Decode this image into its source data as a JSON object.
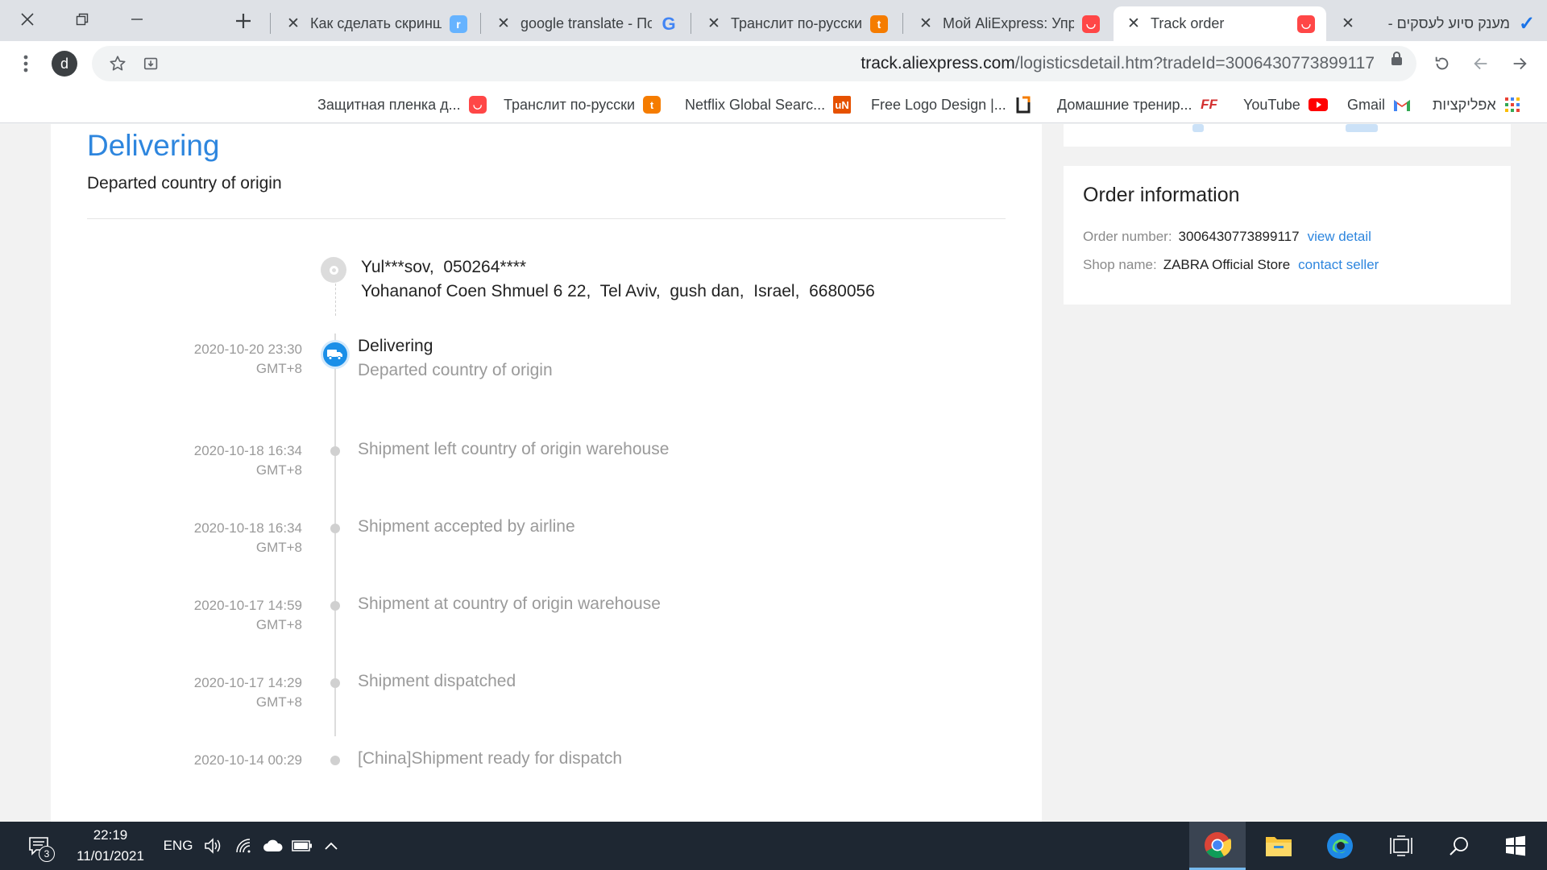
{
  "browser": {
    "tabs": [
      {
        "title": "מענק סיוע לעסקים -",
        "favicon_color": "#1a73e8"
      },
      {
        "title": "Track order",
        "favicon_color": "#ff4747"
      },
      {
        "title": "Мой AliExpress: Упра",
        "favicon_color": "#ff4747"
      },
      {
        "title": "Транслит по-русски",
        "favicon_color": "#f57c00"
      },
      {
        "title": "google translate - По",
        "favicon_color": "#4285f4"
      },
      {
        "title": "Как сделать скриншо",
        "favicon_color": "#66b3ff"
      }
    ],
    "url_domain": "track.aliexpress.com",
    "url_path": "/logisticsdetail.htm?tradeId=3006430773899117",
    "profile_initial": "d",
    "bookmarks": [
      {
        "label": "אפליקציות",
        "icon": "apps-grid-icon"
      },
      {
        "label": "Gmail",
        "icon": "gmail-icon",
        "color": "#ea4335"
      },
      {
        "label": "YouTube",
        "icon": "youtube-icon",
        "color": "#ff0000"
      },
      {
        "label": "Домашние тренир...",
        "icon": "ff-icon",
        "color": "#d32f2f"
      },
      {
        "label": "Free Logo Design |...",
        "icon": "logo-design-icon",
        "color": "#f57c00"
      },
      {
        "label": "Netflix Global Searc...",
        "icon": "un-icon",
        "color": "#e65100"
      },
      {
        "label": "Транслит по-русски",
        "icon": "translit-icon",
        "color": "#f57c00"
      },
      {
        "label": "Защитная пленка д...",
        "icon": "aliexpress-icon",
        "color": "#ff4747"
      }
    ]
  },
  "tracking": {
    "status_title": "Delivering",
    "status_subtitle": "Departed country of origin",
    "recipient_name": "Yul***sov,  050264****",
    "address": "Yohananof Coen Shmuel 6 22,  Tel Aviv,  gush dan,  Israel,  6680056",
    "current_event": {
      "date": "2020-10-20 23:30",
      "tz": "GMT+8",
      "title": "Delivering",
      "desc": "Departed country of origin"
    },
    "events": [
      {
        "date": "2020-10-18 16:34",
        "tz": "GMT+8",
        "desc": "Shipment left country of origin warehouse"
      },
      {
        "date": "2020-10-18 16:34",
        "tz": "GMT+8",
        "desc": "Shipment accepted by airline"
      },
      {
        "date": "2020-10-17 14:59",
        "tz": "GMT+8",
        "desc": "Shipment at country of origin warehouse"
      },
      {
        "date": "2020-10-17 14:29",
        "tz": "GMT+8",
        "desc": "Shipment dispatched"
      },
      {
        "date": "2020-10-14 00:29",
        "tz": "",
        "desc": "[China]Shipment ready for dispatch"
      }
    ]
  },
  "order_info": {
    "title": "Order information",
    "order_number_label": "Order number:",
    "order_number": "3006430773899117",
    "view_detail": "view detail",
    "shop_name_label": "Shop name:",
    "shop_name": "ZABRA Official Store",
    "contact_seller": "contact seller"
  },
  "taskbar": {
    "time": "22:19",
    "date": "11/01/2021",
    "language": "ENG",
    "notification_count": "3"
  },
  "colors": {
    "accent": "#2e86de",
    "active_truck": "#1a8fe8",
    "taskbar": "#1e2732"
  }
}
